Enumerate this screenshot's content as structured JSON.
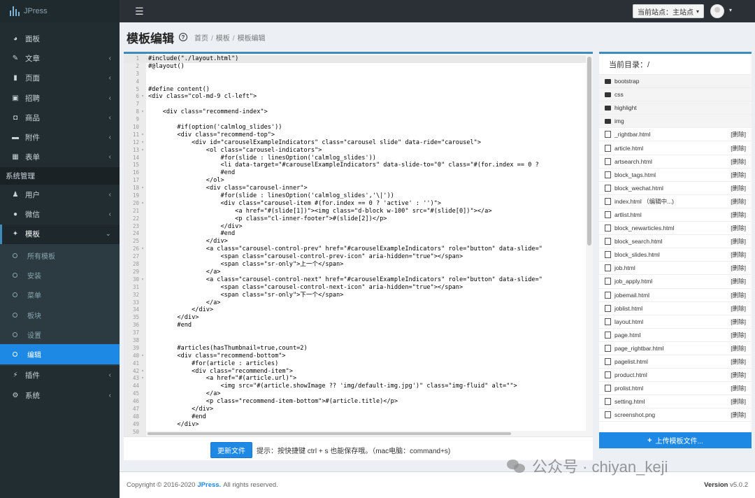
{
  "app": {
    "name": "JPress"
  },
  "sidebar": {
    "items": [
      {
        "label": "面板",
        "icon": "dashboard-icon",
        "glyph": "◕",
        "chevron": false
      },
      {
        "label": "文章",
        "icon": "edit-icon",
        "glyph": "✎",
        "chevron": true
      },
      {
        "label": "页面",
        "icon": "file-icon",
        "glyph": "▮",
        "chevron": true
      },
      {
        "label": "招聘",
        "icon": "briefcase-icon",
        "glyph": "▣",
        "chevron": true
      },
      {
        "label": "商品",
        "icon": "shopping-bag-icon",
        "glyph": "◘",
        "chevron": true
      },
      {
        "label": "附件",
        "icon": "folder-icon",
        "glyph": "▬",
        "chevron": true
      },
      {
        "label": "表单",
        "icon": "table-icon",
        "glyph": "▦",
        "chevron": true
      }
    ],
    "section_header": "系统管理",
    "system_items": [
      {
        "label": "用户",
        "icon": "users-icon",
        "glyph": "♟",
        "chevron": true
      },
      {
        "label": "微信",
        "icon": "wechat-icon",
        "glyph": "●",
        "chevron": true
      }
    ],
    "open_item": {
      "label": "模板",
      "icon": "magic-wand-icon",
      "glyph": "✦",
      "chevron": "⌄"
    },
    "sub_items": [
      {
        "label": "所有模板",
        "active": false
      },
      {
        "label": "安装",
        "active": false
      },
      {
        "label": "菜单",
        "active": false
      },
      {
        "label": "板块",
        "active": false
      },
      {
        "label": "设置",
        "active": false
      },
      {
        "label": "编辑",
        "active": true
      }
    ],
    "bottom_items": [
      {
        "label": "插件",
        "icon": "plug-icon",
        "glyph": "⚡",
        "chevron": true
      },
      {
        "label": "系统",
        "icon": "gear-icon",
        "glyph": "⚙",
        "chevron": true
      }
    ]
  },
  "topbar": {
    "menu_icon": "☰",
    "site_label": "当前站点：主站点",
    "site_caret": "▾",
    "avatar_caret": "▾"
  },
  "header": {
    "title": "模板编辑",
    "help": "?",
    "breadcrumb": [
      "首页",
      "模板",
      "模板编辑"
    ],
    "breadcrumb_sep": "/"
  },
  "editor": {
    "lines": [
      {
        "n": "1",
        "f": "",
        "t": "#include(\"./layout.html\")"
      },
      {
        "n": "2",
        "f": "",
        "t": "#@layout()"
      },
      {
        "n": "3",
        "f": "",
        "t": ""
      },
      {
        "n": "4",
        "f": "",
        "t": ""
      },
      {
        "n": "5",
        "f": "",
        "t": "#define content()"
      },
      {
        "n": "6",
        "f": "▾",
        "t": "<div class=\"col-md-9 cl-left\">"
      },
      {
        "n": "7",
        "f": "",
        "t": ""
      },
      {
        "n": "8",
        "f": "▾",
        "t": "    <div class=\"recommend-index\">"
      },
      {
        "n": "9",
        "f": "",
        "t": ""
      },
      {
        "n": "10",
        "f": "",
        "t": "        #if(option('calmlog_slides'))"
      },
      {
        "n": "11",
        "f": "▾",
        "t": "        <div class=\"recommend-top\">"
      },
      {
        "n": "12",
        "f": "▾",
        "t": "            <div id=\"carouselExampleIndicators\" class=\"carousel slide\" data-ride=\"carousel\">"
      },
      {
        "n": "13",
        "f": "▾",
        "t": "                <ol class=\"carousel-indicators\">"
      },
      {
        "n": "14",
        "f": "",
        "t": "                    #for(slide : linesOption('calmlog_slides'))"
      },
      {
        "n": "15",
        "f": "",
        "t": "                    <li data-target=\"#carouselExampleIndicators\" data-slide-to=\"0\" class=\"#(for.index == 0 ?"
      },
      {
        "n": "16",
        "f": "",
        "t": "                    #end"
      },
      {
        "n": "17",
        "f": "",
        "t": "                </ol>"
      },
      {
        "n": "18",
        "f": "▾",
        "t": "                <div class=\"carousel-inner\">"
      },
      {
        "n": "19",
        "f": "",
        "t": "                    #for(slide : linesOption('calmlog_slides','\\|'))"
      },
      {
        "n": "20",
        "f": "▾",
        "t": "                    <div class=\"carousel-item #(for.index == 0 ? 'active' : '')\">"
      },
      {
        "n": "21",
        "f": "",
        "t": "                        <a href=\"#(slide[1])\"><img class=\"d-block w-100\" src=\"#(slide[0])\"></a>"
      },
      {
        "n": "22",
        "f": "",
        "t": "                        <p class=\"cl-inner-footer\">#(slide[2])</p>"
      },
      {
        "n": "23",
        "f": "",
        "t": "                    </div>"
      },
      {
        "n": "24",
        "f": "",
        "t": "                    #end"
      },
      {
        "n": "25",
        "f": "",
        "t": "                </div>"
      },
      {
        "n": "26",
        "f": "▾",
        "t": "                <a class=\"carousel-control-prev\" href=\"#carouselExampleIndicators\" role=\"button\" data-slide=\""
      },
      {
        "n": "27",
        "f": "",
        "t": "                    <span class=\"carousel-control-prev-icon\" aria-hidden=\"true\"></span>"
      },
      {
        "n": "28",
        "f": "",
        "t": "                    <span class=\"sr-only\">上一个</span>"
      },
      {
        "n": "29",
        "f": "",
        "t": "                </a>"
      },
      {
        "n": "30",
        "f": "▾",
        "t": "                <a class=\"carousel-control-next\" href=\"#carouselExampleIndicators\" role=\"button\" data-slide=\""
      },
      {
        "n": "31",
        "f": "",
        "t": "                    <span class=\"carousel-control-next-icon\" aria-hidden=\"true\"></span>"
      },
      {
        "n": "32",
        "f": "",
        "t": "                    <span class=\"sr-only\">下一个</span>"
      },
      {
        "n": "33",
        "f": "",
        "t": "                </a>"
      },
      {
        "n": "34",
        "f": "",
        "t": "            </div>"
      },
      {
        "n": "35",
        "f": "",
        "t": "        </div>"
      },
      {
        "n": "36",
        "f": "",
        "t": "        #end"
      },
      {
        "n": "37",
        "f": "",
        "t": ""
      },
      {
        "n": "38",
        "f": "",
        "t": ""
      },
      {
        "n": "39",
        "f": "",
        "t": "        #articles(hasThumbnail=true,count=2)"
      },
      {
        "n": "40",
        "f": "▾",
        "t": "        <div class=\"recommend-bottom\">"
      },
      {
        "n": "41",
        "f": "",
        "t": "            #for(article : articles)"
      },
      {
        "n": "42",
        "f": "▾",
        "t": "            <div class=\"recommend-item\">"
      },
      {
        "n": "43",
        "f": "▾",
        "t": "                <a href=\"#(article.url)\">"
      },
      {
        "n": "44",
        "f": "",
        "t": "                    <img src=\"#(article.showImage ?? 'img/default-img.jpg')\" class=\"img-fluid\" alt=\"\">"
      },
      {
        "n": "45",
        "f": "",
        "t": "                </a>"
      },
      {
        "n": "46",
        "f": "",
        "t": "                <p class=\"recommend-item-bottom\">#(article.title)</p>"
      },
      {
        "n": "47",
        "f": "",
        "t": "            </div>"
      },
      {
        "n": "48",
        "f": "",
        "t": "            #end"
      },
      {
        "n": "49",
        "f": "",
        "t": "        </div>"
      },
      {
        "n": "50",
        "f": "",
        "t": ""
      }
    ],
    "update_button": "更新文件",
    "hint": "提示：按快捷键 ctrl + s 也能保存哦。（mac电脑：command+s)"
  },
  "files": {
    "header": "当前目录：/",
    "dirs": [
      "bootstrap",
      "css",
      "highlight",
      "img"
    ],
    "items": [
      {
        "name": "_rightbar.html",
        "action": "[删除]"
      },
      {
        "name": "article.html",
        "action": "[删除]"
      },
      {
        "name": "artsearch.html",
        "action": "[删除]"
      },
      {
        "name": "block_tags.html",
        "action": "[删除]"
      },
      {
        "name": "block_wechat.html",
        "action": "[删除]"
      },
      {
        "name": "index.html （编辑中...)",
        "action": "[删除]"
      },
      {
        "name": "artlist.html",
        "action": "[删除]"
      },
      {
        "name": "block_newarticles.html",
        "action": "[删除]"
      },
      {
        "name": "block_search.html",
        "action": "[删除]"
      },
      {
        "name": "block_slides.html",
        "action": "[删除]"
      },
      {
        "name": "job.html",
        "action": "[删除]"
      },
      {
        "name": "job_apply.html",
        "action": "[删除]"
      },
      {
        "name": "jobemail.html",
        "action": "[删除]"
      },
      {
        "name": "joblist.html",
        "action": "[删除]"
      },
      {
        "name": "layout.html",
        "action": "[删除]"
      },
      {
        "name": "page.html",
        "action": "[删除]"
      },
      {
        "name": "page_rightbar.html",
        "action": "[删除]"
      },
      {
        "name": "pagelist.html",
        "action": "[删除]"
      },
      {
        "name": "product.html",
        "action": "[删除]"
      },
      {
        "name": "prolist.html",
        "action": "[删除]"
      },
      {
        "name": "setting.html",
        "action": "[删除]"
      },
      {
        "name": "screenshot.png",
        "action": "[删除]"
      }
    ],
    "upload_plus": "+",
    "upload_label": "上传模板文件..."
  },
  "footer": {
    "copyright_prefix": "Copyright © 2016-2020",
    "brand": "JPress.",
    "copyright_suffix": "All rights reserved.",
    "version_label": "Version",
    "version_value": "v5.0.2"
  },
  "watermark": {
    "text": "公众号 · chiyan_keji"
  },
  "colors": {
    "accent": "#1e88e5",
    "sidebar_bg": "#222d32",
    "topbar_bg": "#2a3036"
  }
}
